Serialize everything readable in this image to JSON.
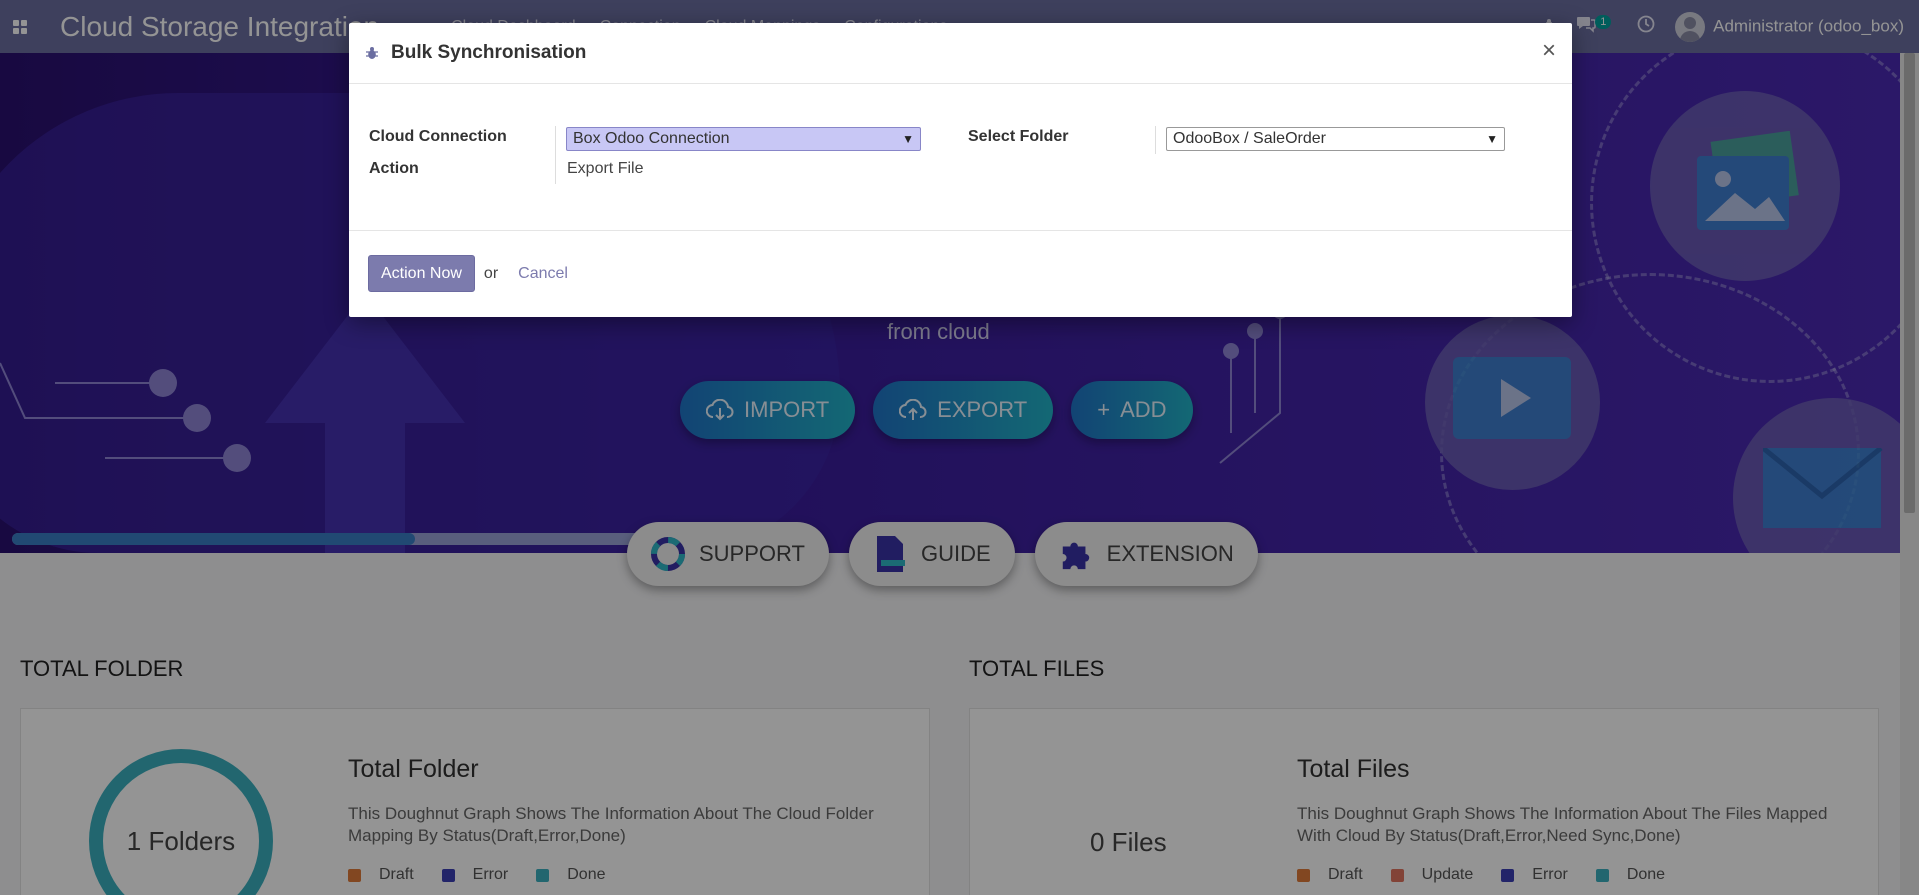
{
  "navbar": {
    "app_title": "Cloud Storage Integration",
    "menu": [
      "Cloud Dashboard",
      "Connection",
      "Cloud Mappings",
      "Configurations"
    ],
    "messages_count": "1",
    "user": "Administrator (odoo_box)"
  },
  "hero": {
    "subtitle": "from cloud",
    "buttons": [
      {
        "label": "IMPORT",
        "icon": "cloud-download-icon"
      },
      {
        "label": "EXPORT",
        "icon": "cloud-upload-icon"
      },
      {
        "label": "ADD",
        "icon": "plus-icon"
      }
    ],
    "progress": 0.63
  },
  "features": [
    {
      "label": "SUPPORT",
      "icon": "lifebuoy-icon"
    },
    {
      "label": "GUIDE",
      "icon": "document-icon"
    },
    {
      "label": "EXTENSION",
      "icon": "puzzle-icon"
    }
  ],
  "stats": {
    "folder_section": "TOTAL FOLDER",
    "files_section": "TOTAL FILES",
    "folder_card": {
      "title": "Total Folder",
      "desc": "This Doughnut Graph Shows The Information About The Cloud Folder Mapping By Status(Draft,Error,Done)",
      "donut_label": "1 Folders",
      "legend": [
        {
          "label": "Draft",
          "color": "#e07b39"
        },
        {
          "label": "Error",
          "color": "#3c3fb5"
        },
        {
          "label": "Done",
          "color": "#3bb0bf"
        }
      ]
    },
    "files_card": {
      "title": "Total Files",
      "desc": "This Doughnut Graph Shows The Information About The Files Mapped With Cloud By Status(Draft,Error,Need Sync,Done)",
      "donut_label": "0 Files",
      "legend": [
        {
          "label": "Draft",
          "color": "#e07b39"
        },
        {
          "label": "Update",
          "color": "#e0745f"
        },
        {
          "label": "Error",
          "color": "#3c3fb5"
        },
        {
          "label": "Done",
          "color": "#3bb0bf"
        }
      ]
    }
  },
  "modal": {
    "title": "Bulk Synchronisation",
    "close": "×",
    "fields": {
      "cloud_connection_label": "Cloud Connection",
      "cloud_connection_value": "Box Odoo Connection",
      "action_label": "Action",
      "action_value": "Export File",
      "select_folder_label": "Select Folder",
      "select_folder_value": "OdooBox / SaleOrder"
    },
    "footer": {
      "primary": "Action Now",
      "or": "or",
      "cancel": "Cancel"
    }
  },
  "colors": {
    "navbar": "#6b6ea1",
    "primary_button": "#7c7bad",
    "hero_gradient_start": "#2a1170",
    "hero_button": "#22b3c9",
    "donut": "#3bb0bf"
  }
}
